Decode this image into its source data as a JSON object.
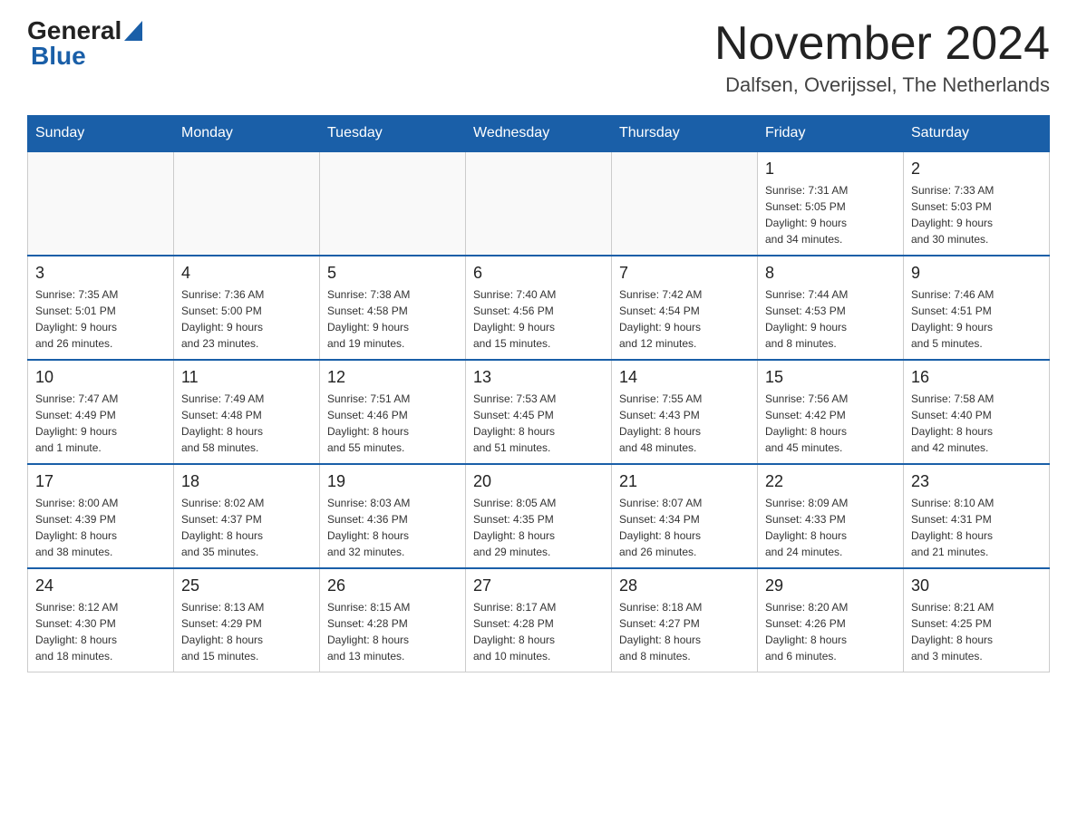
{
  "header": {
    "logo_general": "General",
    "logo_blue": "Blue",
    "month_title": "November 2024",
    "location": "Dalfsen, Overijssel, The Netherlands"
  },
  "calendar": {
    "days_of_week": [
      "Sunday",
      "Monday",
      "Tuesday",
      "Wednesday",
      "Thursday",
      "Friday",
      "Saturday"
    ],
    "weeks": [
      [
        {
          "day": "",
          "info": ""
        },
        {
          "day": "",
          "info": ""
        },
        {
          "day": "",
          "info": ""
        },
        {
          "day": "",
          "info": ""
        },
        {
          "day": "",
          "info": ""
        },
        {
          "day": "1",
          "info": "Sunrise: 7:31 AM\nSunset: 5:05 PM\nDaylight: 9 hours\nand 34 minutes."
        },
        {
          "day": "2",
          "info": "Sunrise: 7:33 AM\nSunset: 5:03 PM\nDaylight: 9 hours\nand 30 minutes."
        }
      ],
      [
        {
          "day": "3",
          "info": "Sunrise: 7:35 AM\nSunset: 5:01 PM\nDaylight: 9 hours\nand 26 minutes."
        },
        {
          "day": "4",
          "info": "Sunrise: 7:36 AM\nSunset: 5:00 PM\nDaylight: 9 hours\nand 23 minutes."
        },
        {
          "day": "5",
          "info": "Sunrise: 7:38 AM\nSunset: 4:58 PM\nDaylight: 9 hours\nand 19 minutes."
        },
        {
          "day": "6",
          "info": "Sunrise: 7:40 AM\nSunset: 4:56 PM\nDaylight: 9 hours\nand 15 minutes."
        },
        {
          "day": "7",
          "info": "Sunrise: 7:42 AM\nSunset: 4:54 PM\nDaylight: 9 hours\nand 12 minutes."
        },
        {
          "day": "8",
          "info": "Sunrise: 7:44 AM\nSunset: 4:53 PM\nDaylight: 9 hours\nand 8 minutes."
        },
        {
          "day": "9",
          "info": "Sunrise: 7:46 AM\nSunset: 4:51 PM\nDaylight: 9 hours\nand 5 minutes."
        }
      ],
      [
        {
          "day": "10",
          "info": "Sunrise: 7:47 AM\nSunset: 4:49 PM\nDaylight: 9 hours\nand 1 minute."
        },
        {
          "day": "11",
          "info": "Sunrise: 7:49 AM\nSunset: 4:48 PM\nDaylight: 8 hours\nand 58 minutes."
        },
        {
          "day": "12",
          "info": "Sunrise: 7:51 AM\nSunset: 4:46 PM\nDaylight: 8 hours\nand 55 minutes."
        },
        {
          "day": "13",
          "info": "Sunrise: 7:53 AM\nSunset: 4:45 PM\nDaylight: 8 hours\nand 51 minutes."
        },
        {
          "day": "14",
          "info": "Sunrise: 7:55 AM\nSunset: 4:43 PM\nDaylight: 8 hours\nand 48 minutes."
        },
        {
          "day": "15",
          "info": "Sunrise: 7:56 AM\nSunset: 4:42 PM\nDaylight: 8 hours\nand 45 minutes."
        },
        {
          "day": "16",
          "info": "Sunrise: 7:58 AM\nSunset: 4:40 PM\nDaylight: 8 hours\nand 42 minutes."
        }
      ],
      [
        {
          "day": "17",
          "info": "Sunrise: 8:00 AM\nSunset: 4:39 PM\nDaylight: 8 hours\nand 38 minutes."
        },
        {
          "day": "18",
          "info": "Sunrise: 8:02 AM\nSunset: 4:37 PM\nDaylight: 8 hours\nand 35 minutes."
        },
        {
          "day": "19",
          "info": "Sunrise: 8:03 AM\nSunset: 4:36 PM\nDaylight: 8 hours\nand 32 minutes."
        },
        {
          "day": "20",
          "info": "Sunrise: 8:05 AM\nSunset: 4:35 PM\nDaylight: 8 hours\nand 29 minutes."
        },
        {
          "day": "21",
          "info": "Sunrise: 8:07 AM\nSunset: 4:34 PM\nDaylight: 8 hours\nand 26 minutes."
        },
        {
          "day": "22",
          "info": "Sunrise: 8:09 AM\nSunset: 4:33 PM\nDaylight: 8 hours\nand 24 minutes."
        },
        {
          "day": "23",
          "info": "Sunrise: 8:10 AM\nSunset: 4:31 PM\nDaylight: 8 hours\nand 21 minutes."
        }
      ],
      [
        {
          "day": "24",
          "info": "Sunrise: 8:12 AM\nSunset: 4:30 PM\nDaylight: 8 hours\nand 18 minutes."
        },
        {
          "day": "25",
          "info": "Sunrise: 8:13 AM\nSunset: 4:29 PM\nDaylight: 8 hours\nand 15 minutes."
        },
        {
          "day": "26",
          "info": "Sunrise: 8:15 AM\nSunset: 4:28 PM\nDaylight: 8 hours\nand 13 minutes."
        },
        {
          "day": "27",
          "info": "Sunrise: 8:17 AM\nSunset: 4:28 PM\nDaylight: 8 hours\nand 10 minutes."
        },
        {
          "day": "28",
          "info": "Sunrise: 8:18 AM\nSunset: 4:27 PM\nDaylight: 8 hours\nand 8 minutes."
        },
        {
          "day": "29",
          "info": "Sunrise: 8:20 AM\nSunset: 4:26 PM\nDaylight: 8 hours\nand 6 minutes."
        },
        {
          "day": "30",
          "info": "Sunrise: 8:21 AM\nSunset: 4:25 PM\nDaylight: 8 hours\nand 3 minutes."
        }
      ]
    ]
  }
}
